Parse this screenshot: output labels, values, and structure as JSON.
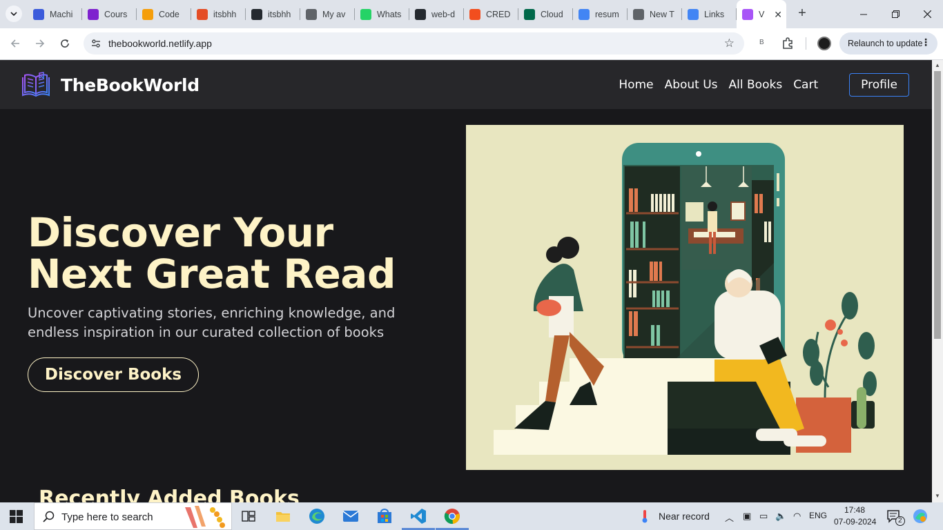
{
  "browser": {
    "tabs": [
      {
        "label": "Machi",
        "icon": "s-logo-icon",
        "color": "#3b5bdb"
      },
      {
        "label": "Cours",
        "icon": "course-icon",
        "color": "#7e22ce"
      },
      {
        "label": "Code",
        "icon": "code-icon",
        "color": "#f59e0b"
      },
      {
        "label": "itsbhh",
        "icon": "bracket-icon",
        "color": "#e44d26"
      },
      {
        "label": "itsbhh",
        "icon": "github-icon",
        "color": "#24292f"
      },
      {
        "label": "My av",
        "icon": "globe-icon",
        "color": "#5f6368"
      },
      {
        "label": "Whats",
        "icon": "whatsapp-icon",
        "color": "#25d366"
      },
      {
        "label": "web-d",
        "icon": "github-icon",
        "color": "#24292f"
      },
      {
        "label": "CREDI",
        "icon": "figma-icon",
        "color": "#f24e1e"
      },
      {
        "label": "Cloud",
        "icon": "mongodb-icon",
        "color": "#00684a"
      },
      {
        "label": "resum",
        "icon": "docs-icon",
        "color": "#4285f4"
      },
      {
        "label": "New T",
        "icon": "chrome-icon",
        "color": "#5f6368"
      },
      {
        "label": "Links",
        "icon": "docs-icon",
        "color": "#4285f4"
      },
      {
        "label": "V",
        "icon": "vite-icon",
        "color": "#a855f7"
      }
    ],
    "url": "thebookworld.netlify.app",
    "profile_letter": "B",
    "relaunch_label": "Relaunch to update"
  },
  "site": {
    "brand": "TheBookWorld",
    "nav": [
      "Home",
      "About Us",
      "All Books",
      "Cart"
    ],
    "profile_label": "Profile",
    "hero": {
      "title": "Discover Your Next Great Read",
      "subtitle": "Uncover captivating stories, enriching knowledge, and endless inspiration in our curated collection of books",
      "button": "Discover Books"
    },
    "recent_heading": "Recently Added Books"
  },
  "taskbar": {
    "search_placeholder": "Type here to search",
    "weather": "Near record",
    "language": "ENG",
    "time": "17:48",
    "date": "07-09-2024",
    "notifications": "2"
  },
  "colors": {
    "page_bg": "#18181b",
    "nav_bg": "#27272a",
    "hero_text": "#fef3c7",
    "profile_border": "#3b82f6"
  }
}
